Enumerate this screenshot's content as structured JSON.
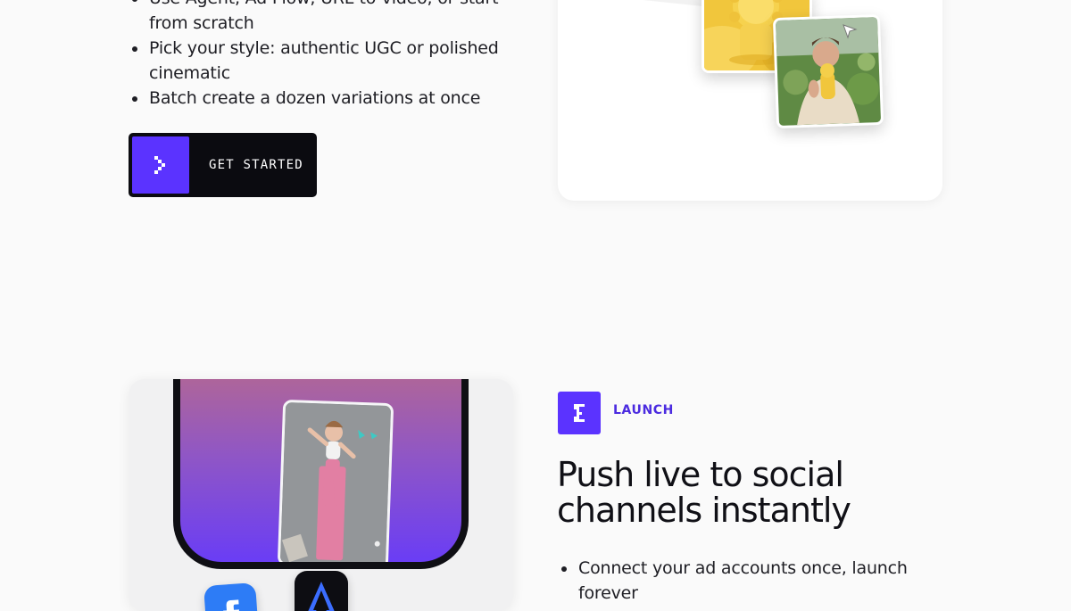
{
  "feature_create": {
    "bullets": [
      "Use Agent, Ad Flow, URL-to-video, or start from scratch",
      "Pick your style: authentic UGC or polished cinematic",
      "Batch create a dozen variations at once"
    ],
    "cta": {
      "label": "GET STARTED",
      "icon": "chevron-right-pixel-icon",
      "accent": "#5b33ff"
    }
  },
  "feature_launch": {
    "tag": {
      "label": "LAUNCH",
      "icon": "launch-pixel-icon",
      "accent": "#5b33ff"
    },
    "headline": "Push live to social channels instantly",
    "bullets": [
      "Connect your ad accounts once, launch forever"
    ]
  },
  "media": {
    "product_thumbnail": "sunscreen-product-image",
    "creator_thumbnail": "creator-holding-product-image",
    "cursor_icon": "cursor-arrow-icon",
    "phone_video": "yoga-workout-video",
    "app_icons": [
      "facebook-icon",
      "aragon-a-icon"
    ]
  }
}
